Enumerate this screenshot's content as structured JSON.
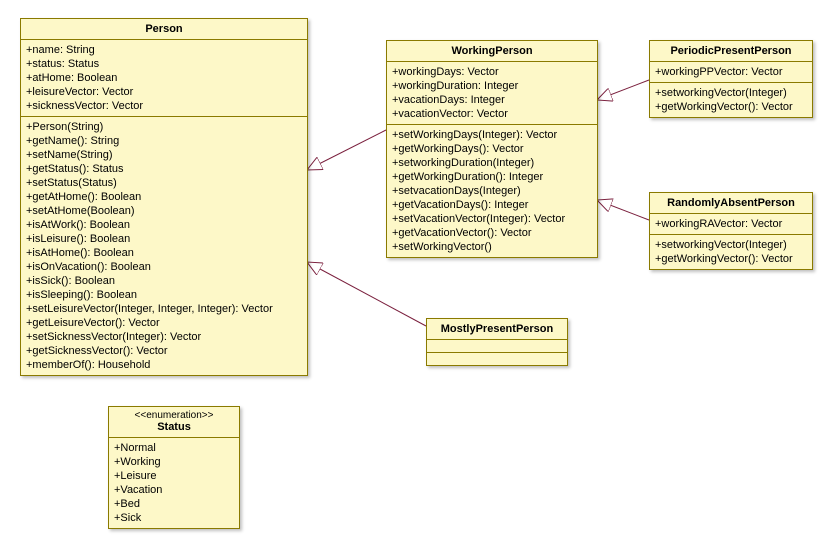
{
  "classes": {
    "person": {
      "title": "Person",
      "attrs": [
        "+name: String",
        "+status: Status",
        "+atHome: Boolean",
        "+leisureVector: Vector",
        "+sicknessVector: Vector"
      ],
      "ops": [
        "+Person(String)",
        "+getName(): String",
        "+setName(String)",
        "+getStatus(): Status",
        "+setStatus(Status)",
        "+getAtHome(): Boolean",
        "+setAtHome(Boolean)",
        "+isAtWork(): Boolean",
        "+isLeisure(): Boolean",
        "+isAtHome(): Boolean",
        "+isOnVacation(): Boolean",
        "+isSick(): Boolean",
        "+isSleeping(): Boolean",
        "+setLeisureVector(Integer, Integer, Integer): Vector",
        "+getLeisureVector(): Vector",
        "+setSicknessVector(Integer): Vector",
        "+getSicknessVector(): Vector",
        "+memberOf(): Household"
      ]
    },
    "workingPerson": {
      "title": "WorkingPerson",
      "attrs": [
        "+workingDays: Vector",
        "+workingDuration: Integer",
        "+vacationDays: Integer",
        "+vacationVector: Vector"
      ],
      "ops": [
        "+setWorkingDays(Integer): Vector",
        "+getWorkingDays(): Vector",
        "+setworkingDuration(Integer)",
        "+getWorkingDuration(): Integer",
        "+setvacationDays(Integer)",
        "+getVacationDays(): Integer",
        "+setVacationVector(Integer): Vector",
        "+getVacationVector(): Vector",
        "+setWorkingVector()"
      ]
    },
    "periodicPresentPerson": {
      "title": "PeriodicPresentPerson",
      "attrs": [
        "+workingPPVector: Vector"
      ],
      "ops": [
        "+setworkingVector(Integer)",
        "+getWorkingVector(): Vector"
      ]
    },
    "randomlyAbsentPerson": {
      "title": "RandomlyAbsentPerson",
      "attrs": [
        "+workingRAVector: Vector"
      ],
      "ops": [
        "+setworkingVector(Integer)",
        "+getWorkingVector(): Vector"
      ]
    },
    "mostlyPresentPerson": {
      "title": "MostlyPresentPerson"
    },
    "status": {
      "stereotype": "<<enumeration>>",
      "title": "Status",
      "literals": [
        "+Normal",
        "+Working",
        "+Leisure",
        "+Vacation",
        "+Bed",
        "+Sick"
      ]
    }
  }
}
